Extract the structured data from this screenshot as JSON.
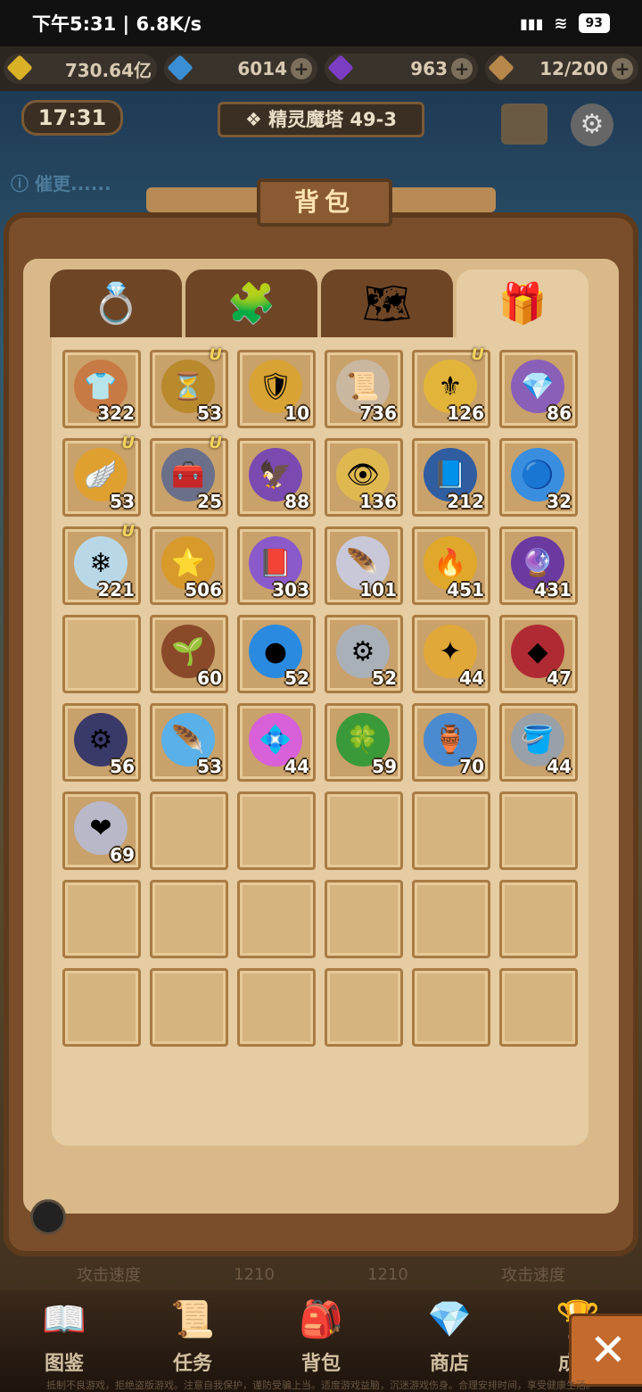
{
  "statusbar": {
    "time": "下午5:31 | 6.8K/s",
    "battery": "93"
  },
  "resources": [
    {
      "value": "730.64亿",
      "color": "#d9b127"
    },
    {
      "value": "6014",
      "color": "#3a8ed3"
    },
    {
      "value": "963",
      "color": "#7b3ec3"
    },
    {
      "value": "12/200",
      "color": "#b8884a"
    }
  ],
  "hud": {
    "clock": "17:31",
    "stage": "精灵魔塔 49-3",
    "urge_text": "催更......"
  },
  "panel": {
    "title": "背包"
  },
  "tabs": [
    {
      "icon": "ring-icon",
      "glyph": "💍"
    },
    {
      "icon": "puzzle-icon",
      "glyph": "🧩"
    },
    {
      "icon": "map-icon",
      "glyph": "🗺"
    },
    {
      "icon": "treasure-chest-icon",
      "glyph": "🎁"
    }
  ],
  "items": [
    {
      "icon": "shirt-token-icon",
      "glyph": "👕",
      "count": "322",
      "u": false,
      "bg": "#c87a44"
    },
    {
      "icon": "hourglass-icon",
      "glyph": "⏳",
      "count": "53",
      "u": true,
      "bg": "#b88a2c"
    },
    {
      "icon": "gold-badge-icon",
      "glyph": "🛡",
      "count": "10",
      "u": false,
      "bg": "#d8a334"
    },
    {
      "icon": "scroll-icon",
      "glyph": "📜",
      "count": "736",
      "u": false,
      "bg": "#c9b7a0"
    },
    {
      "icon": "gold-ingot-icon",
      "glyph": "⚜",
      "count": "126",
      "u": true,
      "bg": "#e2b43a"
    },
    {
      "icon": "gem-pile-icon",
      "glyph": "💎",
      "count": "86",
      "u": false,
      "bg": "#8a5fb8"
    },
    {
      "icon": "winged-gem-icon",
      "glyph": "🪽",
      "count": "53",
      "u": true,
      "bg": "#e0a030"
    },
    {
      "icon": "chest-icon",
      "glyph": "🧰",
      "count": "25",
      "u": true,
      "bg": "#6a6f8a"
    },
    {
      "icon": "claw-icon",
      "glyph": "🦅",
      "count": "88",
      "u": false,
      "bg": "#7a4ab0"
    },
    {
      "icon": "eye-orb-icon",
      "glyph": "👁",
      "count": "136",
      "u": false,
      "bg": "#e0b850"
    },
    {
      "icon": "blue-book-icon",
      "glyph": "📘",
      "count": "212",
      "u": false,
      "bg": "#2f5da0"
    },
    {
      "icon": "blue-flame-orb-icon",
      "glyph": "🔵",
      "count": "32",
      "u": false,
      "bg": "#3a8ee0"
    },
    {
      "icon": "ice-crystal-icon",
      "glyph": "❄",
      "count": "221",
      "u": true,
      "bg": "#b8d8e8"
    },
    {
      "icon": "gold-star-icon",
      "glyph": "⭐",
      "count": "506",
      "u": false,
      "bg": "#d89a2a"
    },
    {
      "icon": "purple-book-icon",
      "glyph": "📕",
      "count": "303",
      "u": false,
      "bg": "#8a5acb"
    },
    {
      "icon": "feather-quill-icon",
      "glyph": "🪶",
      "count": "101",
      "u": false,
      "bg": "#c8c8d8"
    },
    {
      "icon": "gold-flame-icon",
      "glyph": "🔥",
      "count": "451",
      "u": false,
      "bg": "#e0a82a"
    },
    {
      "icon": "purple-crystal-icon",
      "glyph": "🔮",
      "count": "431",
      "u": false,
      "bg": "#6a3aa0"
    },
    {
      "icon": "",
      "glyph": "",
      "count": "",
      "u": false,
      "bg": ""
    },
    {
      "icon": "root-sprout-icon",
      "glyph": "🌱",
      "count": "60",
      "u": false,
      "bg": "#8a4a2a"
    },
    {
      "icon": "blue-orb-icon",
      "glyph": "●",
      "count": "52",
      "u": false,
      "bg": "#2a8ae0"
    },
    {
      "icon": "wheel-icon",
      "glyph": "⚙",
      "count": "52",
      "u": false,
      "bg": "#aab0b8"
    },
    {
      "icon": "gold-nugget-icon",
      "glyph": "✦",
      "count": "44",
      "u": false,
      "bg": "#e0a838"
    },
    {
      "icon": "red-ore-icon",
      "glyph": "◆",
      "count": "47",
      "u": false,
      "bg": "#b02a34"
    },
    {
      "icon": "dark-gear-icon",
      "glyph": "⚙",
      "count": "56",
      "u": false,
      "bg": "#3a3a6a"
    },
    {
      "icon": "blue-feather-icon",
      "glyph": "🪶",
      "count": "53",
      "u": false,
      "bg": "#5ab0e8"
    },
    {
      "icon": "pink-crystal-icon",
      "glyph": "💠",
      "count": "44",
      "u": false,
      "bg": "#d860d8"
    },
    {
      "icon": "four-leaf-clover-icon",
      "glyph": "🍀",
      "count": "59",
      "u": false,
      "bg": "#3a9a3a"
    },
    {
      "icon": "potion-jar-icon",
      "glyph": "🏺",
      "count": "70",
      "u": false,
      "bg": "#4a8ad0"
    },
    {
      "icon": "gold-bucket-icon",
      "glyph": "🪣",
      "count": "44",
      "u": false,
      "bg": "#9aa0a8"
    },
    {
      "icon": "heart-jar-icon",
      "glyph": "❤",
      "count": "69",
      "u": false,
      "bg": "#b8b8c8"
    }
  ],
  "stats": {
    "left_label": "攻击速度",
    "left_value": "1210",
    "right_value": "1210",
    "right_label": "攻击速度"
  },
  "nav": [
    {
      "label": "图鉴",
      "icon": "codex-icon",
      "glyph": "📖"
    },
    {
      "label": "任务",
      "icon": "quest-scroll-icon",
      "glyph": "📜"
    },
    {
      "label": "背包",
      "icon": "backpack-icon",
      "glyph": "🎒"
    },
    {
      "label": "商店",
      "icon": "shop-chest-icon",
      "glyph": "💎"
    },
    {
      "label": "成就",
      "icon": "achievement-icon",
      "glyph": "🏆"
    }
  ],
  "close_glyph": "✕",
  "disclaimer": "抵制不良游戏，拒绝盗版游戏。注意自我保护，谨防受骗上当。适度游戏益脑，沉迷游戏伤身。合理安排时间，享受健康生活。"
}
